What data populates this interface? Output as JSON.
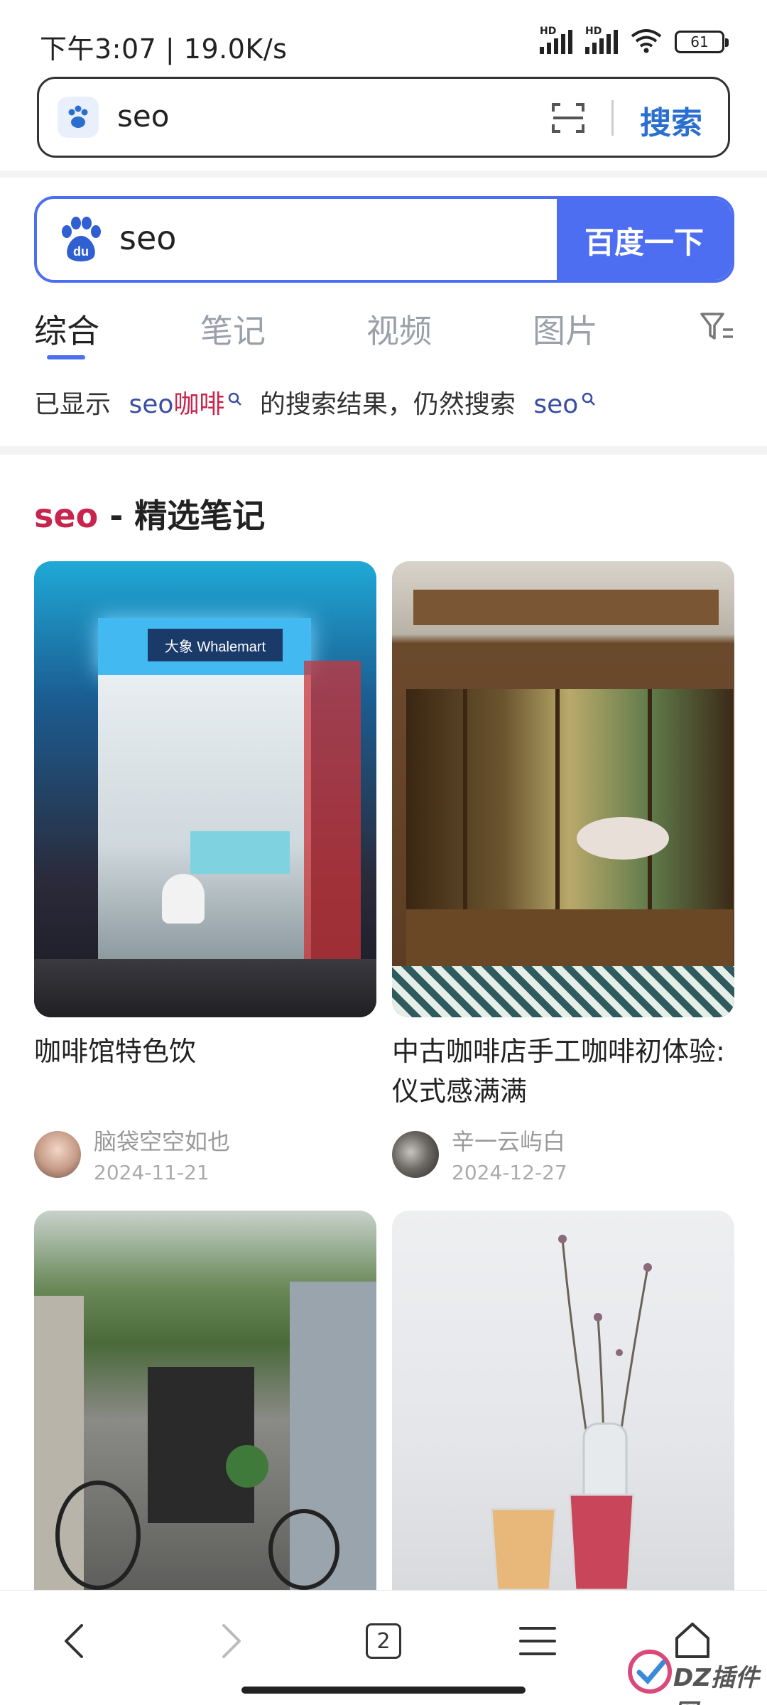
{
  "status_bar": {
    "time": "下午3:07 | 19.0K/s",
    "signal1_label": "HD",
    "signal2_label": "HD",
    "battery": "61"
  },
  "browser_bar": {
    "query": "seo",
    "search_label": "搜索",
    "icons": [
      "baidu-paw-icon",
      "scan-icon"
    ]
  },
  "baidu_search": {
    "query": "seo",
    "submit_label": "百度一下",
    "logo_text": "du"
  },
  "tabs": [
    {
      "label": "综合",
      "active": true
    },
    {
      "label": "笔记",
      "active": false
    },
    {
      "label": "视频",
      "active": false
    },
    {
      "label": "图片",
      "active": false
    }
  ],
  "hint": {
    "prefix": "已显示",
    "suggested_kw": "seo",
    "suggested_suffix": "咖啡",
    "middle": "的搜索结果，仍然搜索",
    "original_kw": "seo"
  },
  "section": {
    "keyword": "seo",
    "title": " - 精选笔记"
  },
  "cards": [
    {
      "title": "咖啡馆特色饮",
      "author": "脑袋空空如也",
      "date": "2024-11-21",
      "sign": "大象 Whalemart"
    },
    {
      "title": "中古咖啡店手工咖啡初体验:\n仪式感满满",
      "author": "辛一云屿白",
      "date": "2024-12-27"
    },
    {
      "title": "",
      "author": "",
      "date": ""
    },
    {
      "title": "",
      "author": "",
      "date": ""
    }
  ],
  "bottom_nav": {
    "tab_count": "2",
    "items": [
      "back-icon",
      "forward-icon",
      "tabs-icon",
      "menu-icon",
      "home-icon"
    ]
  },
  "watermark": {
    "text": "DZ插件网"
  },
  "colors": {
    "accent": "#4e6ef2",
    "keyword_red": "#c7254e",
    "link_blue": "#3a4ea0",
    "muted": "#9aa0aa"
  }
}
